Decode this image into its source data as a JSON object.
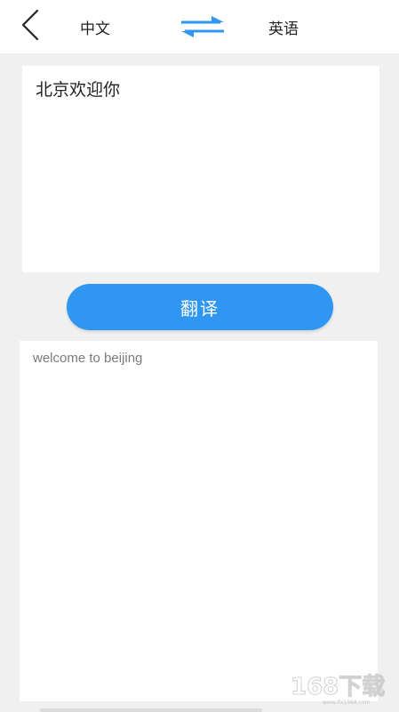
{
  "header": {
    "source_lang": "中文",
    "target_lang": "英语"
  },
  "input": {
    "text": "北京欢迎你"
  },
  "translate_button": {
    "label": "翻译"
  },
  "output": {
    "text": "welcome to beijing"
  },
  "watermark": {
    "text": "168下载",
    "url": "www.ifx1968.com"
  },
  "colors": {
    "accent": "#2f96f2",
    "background": "#f0f0f0",
    "card": "#ffffff"
  },
  "icons": {
    "back": "chevron-left-icon",
    "swap": "swap-arrows-icon"
  }
}
